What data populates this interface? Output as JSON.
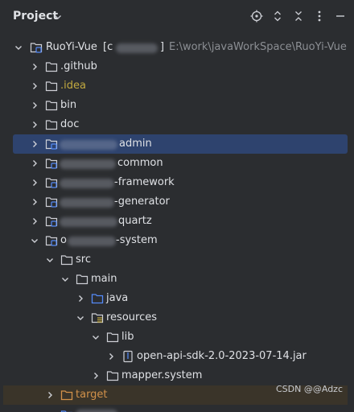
{
  "header": {
    "title": "Project",
    "icons": [
      "locate-icon",
      "expand-collapse-icon",
      "close-icon",
      "more-icon"
    ]
  },
  "tree": {
    "root": {
      "name": "RuoYi-Vue",
      "name_suffix": "[c",
      "name_close": "]",
      "path": "E:\\work\\javaWorkSpace\\RuoYi-Vue"
    },
    "items": {
      "github": ".github",
      "idea": ".idea",
      "bin": "bin",
      "doc": "doc",
      "admin": "admin",
      "common": "common",
      "framework": "-framework",
      "generator": "-generator",
      "quartz": "quartz",
      "system_prefix": "o",
      "system": "-system",
      "src": "src",
      "main": "main",
      "java": "java",
      "resources": "resources",
      "lib": "lib",
      "jar": "open-api-sdk-2.0-2023-07-14.jar",
      "mapper": "mapper.system",
      "target": "target"
    }
  },
  "colors": {
    "background": "#2b2d30",
    "selected": "#2e436e",
    "ignored": "#c2a93f",
    "excluded": "#d2914a",
    "source_folder": "#548af7"
  },
  "watermark": "CSDN @@Adzc"
}
